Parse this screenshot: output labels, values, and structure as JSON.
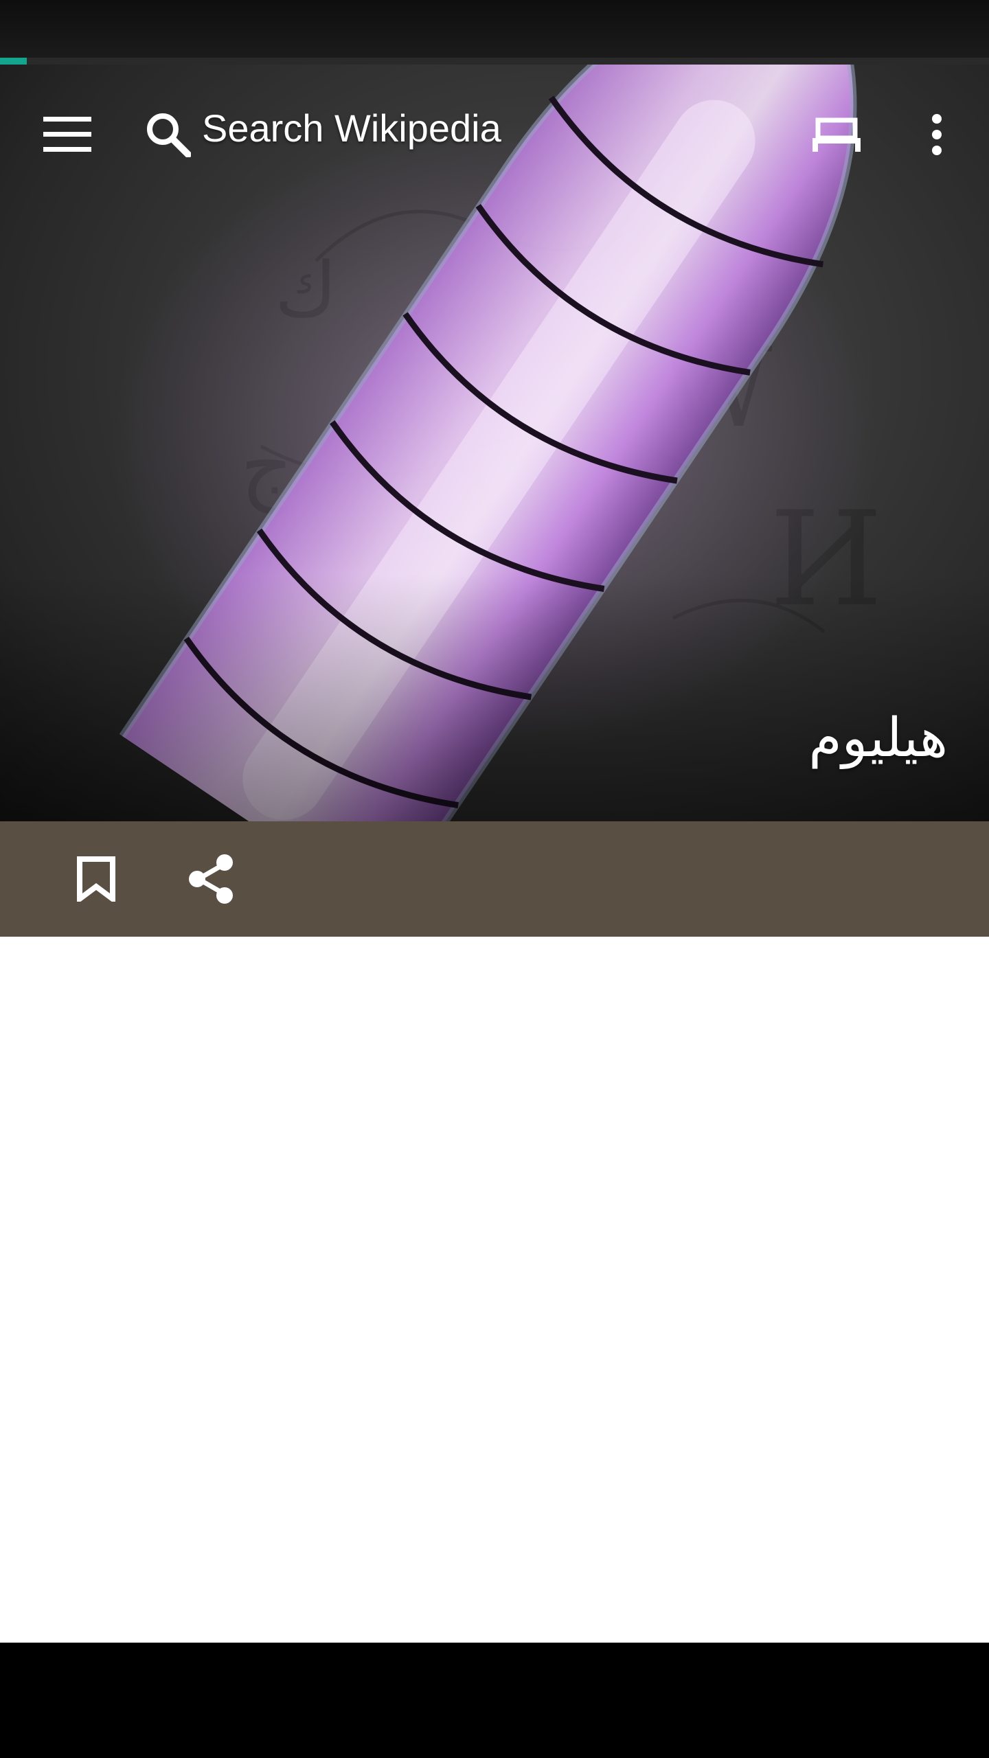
{
  "toolbar": {
    "search_placeholder": "Search Wikipedia",
    "menu_icon": "hamburger-menu-icon",
    "search_icon": "search-icon",
    "tabs_icon": "tabs-icon",
    "more_icon": "more-vertical-icon"
  },
  "progress": {
    "fraction": 0.027
  },
  "article": {
    "title": "هيليوم",
    "hero_image": "helium discharge tube glowing purple"
  },
  "actions": {
    "save_icon": "bookmark-icon",
    "share_icon": "share-icon"
  },
  "colors": {
    "accent": "#14a58f",
    "action_bar": "#5a4f43",
    "glow": "#c98be8"
  }
}
